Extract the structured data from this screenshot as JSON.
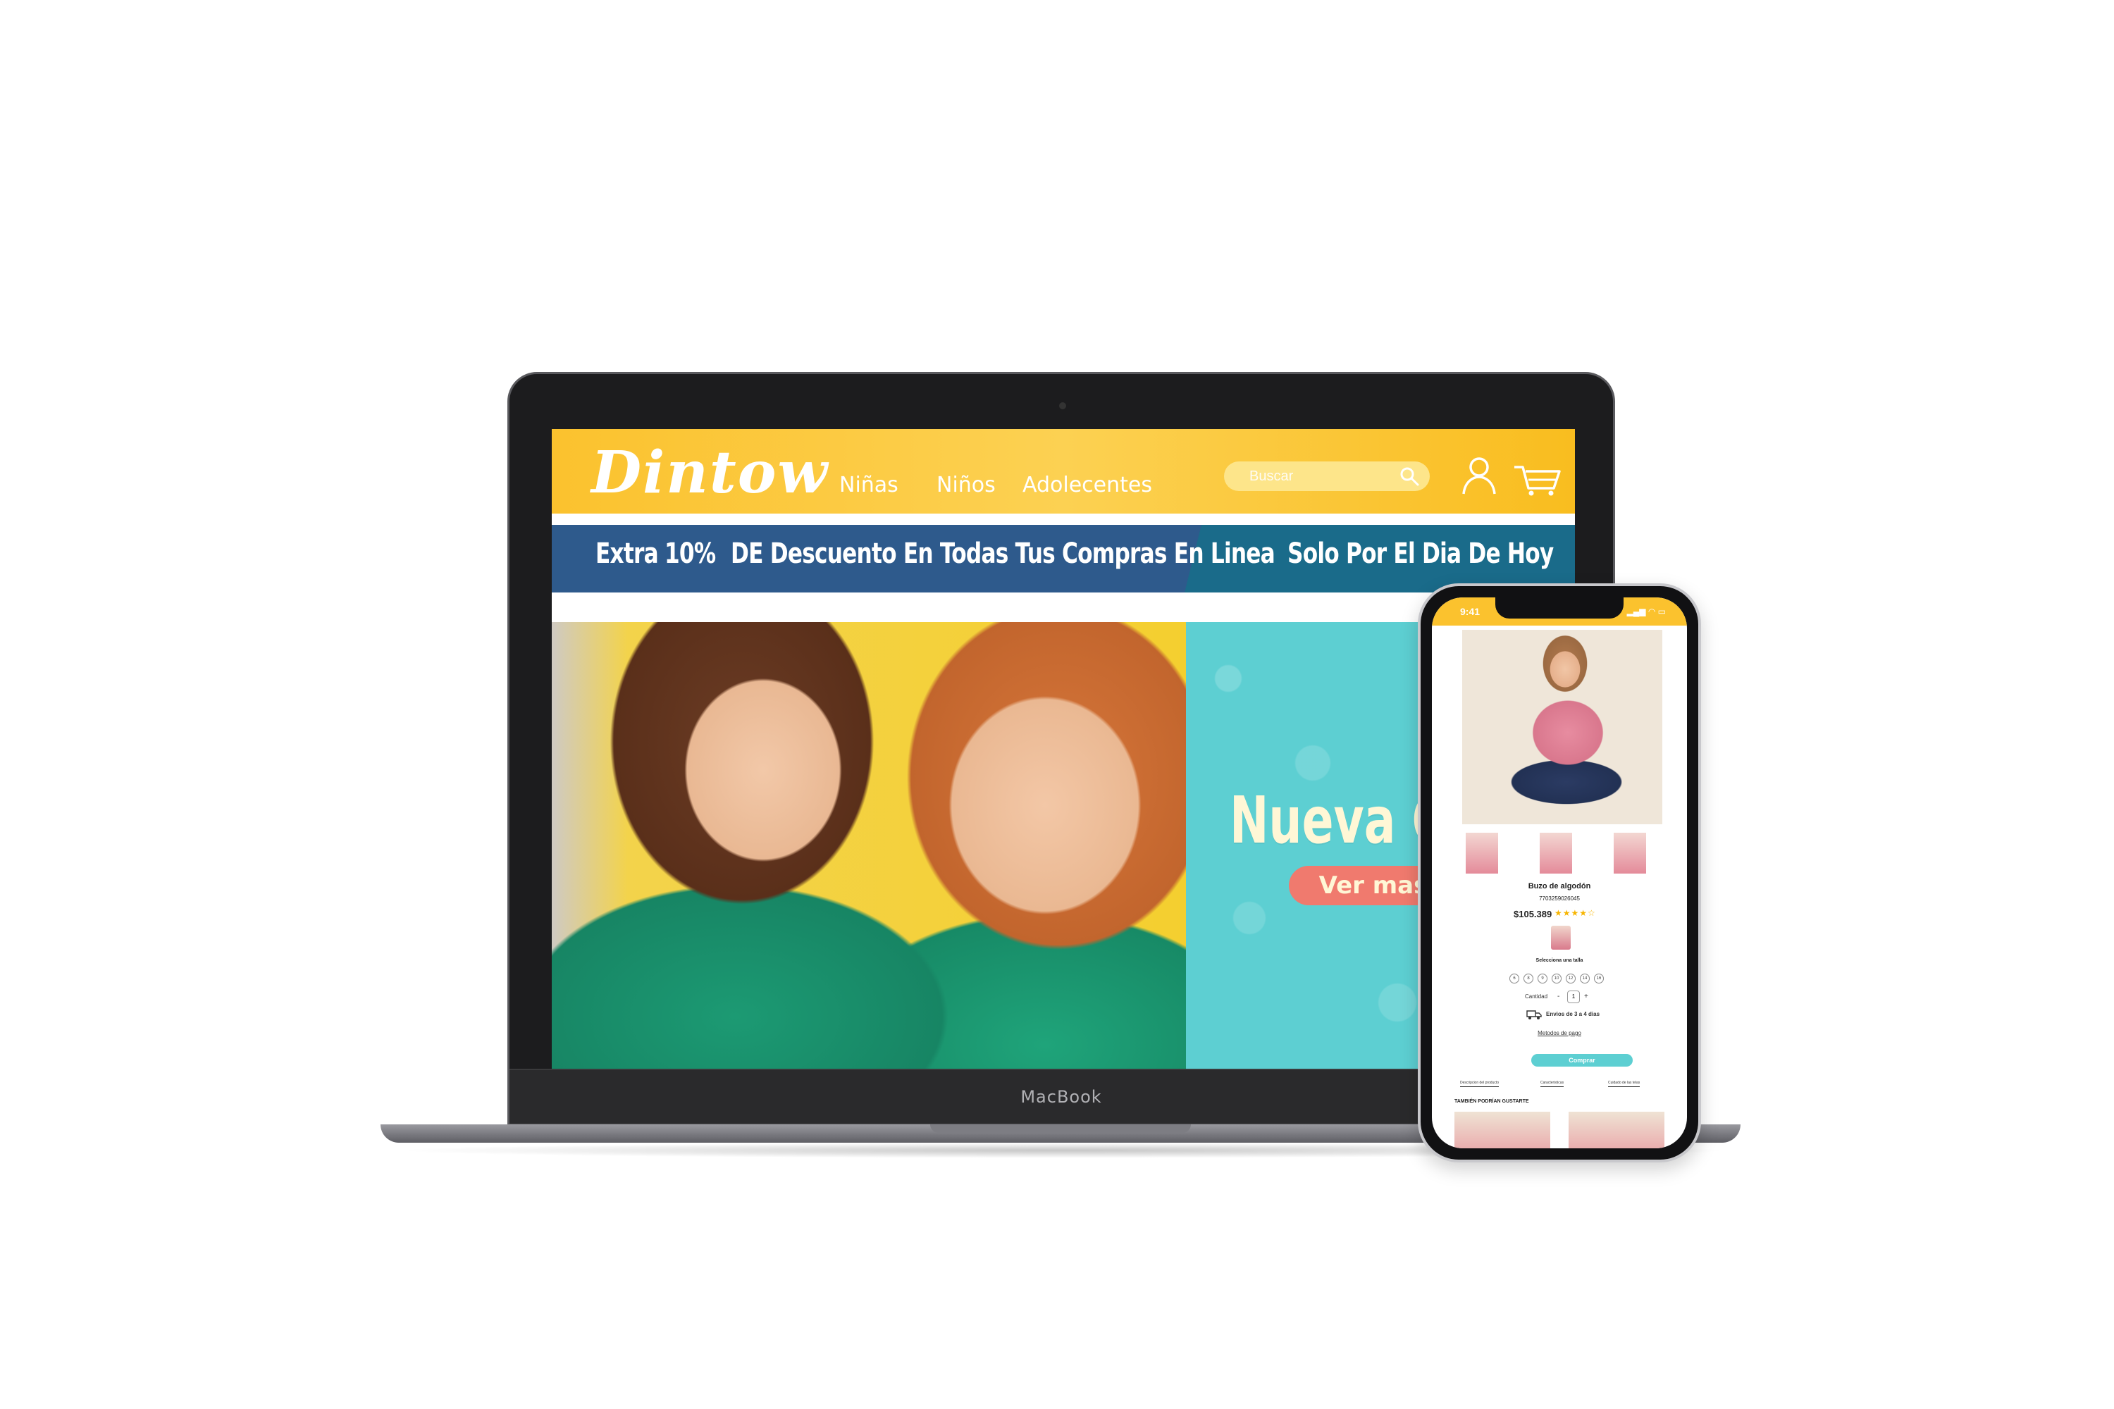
{
  "laptop": {
    "brand": "MacBook",
    "site": {
      "logo": "Dintow",
      "nav": [
        "Niñas",
        "Niños",
        "Adolecentes"
      ],
      "search_placeholder": "Buscar",
      "promo": {
        "extra": "Extra",
        "percent": "10%",
        "discount_text": "DE Descuento En Todas Tus Compras En Linea",
        "right_text": "Solo Por El Dia De Hoy"
      },
      "hero": {
        "title": "Nueva Col",
        "button": "Ver mas"
      }
    }
  },
  "phone": {
    "status_time": "9:41",
    "product": {
      "name": "Buzo de algodón",
      "sku": "7703259026045",
      "price": "$105.389",
      "stars": "★★★★☆",
      "size_label": "Selecciona una talla",
      "sizes": [
        "6",
        "8",
        "9",
        "10",
        "12",
        "14",
        "16"
      ],
      "qty_label": "Cantidad",
      "qty_value": "1",
      "qty_minus": "-",
      "qty_plus": "+",
      "shipping": "Envios de 3 a 4 dias",
      "payment_link": "Metodos de pago",
      "buy_button": "Comprar",
      "tabs": [
        "Descripcion del producto",
        "Caracteristicas",
        "Cuidado de las telas"
      ],
      "also_like": "TAMBIÉN PODRÍAN GUSTARTE"
    }
  },
  "colors": {
    "brand_yellow": "#fbc22e",
    "promo_blue": "#2e5a8c",
    "hero_teal": "#5dcfd2",
    "button_coral": "#f07a6e"
  }
}
